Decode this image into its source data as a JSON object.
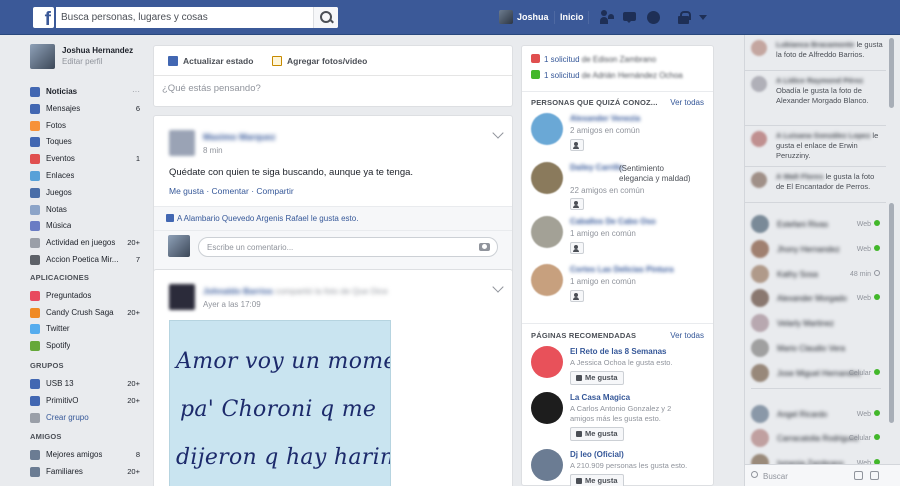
{
  "topbar": {
    "logo": "f",
    "search_placeholder": "Busca personas, lugares y cosas",
    "user_name": "Joshua",
    "home": "Inicio"
  },
  "left": {
    "profile_name": "Joshua Hernandez",
    "edit_profile": "Editar perfil",
    "nav": [
      {
        "label": "Noticias",
        "count": "",
        "color": "#4267b2",
        "active": true,
        "menu": true
      },
      {
        "label": "Mensajes",
        "count": "6",
        "color": "#4267b2"
      },
      {
        "label": "Fotos",
        "count": "",
        "color": "#f7923a"
      },
      {
        "label": "Toques",
        "count": "",
        "color": "#4267b2"
      },
      {
        "label": "Eventos",
        "count": "1",
        "color": "#e04f4f"
      },
      {
        "label": "Enlaces",
        "count": "",
        "color": "#58a1d8"
      },
      {
        "label": "Juegos",
        "count": "",
        "color": "#4a6ea8"
      },
      {
        "label": "Notas",
        "count": "",
        "color": "#8ca4c8"
      },
      {
        "label": "Música",
        "count": "",
        "color": "#6a7cc4"
      },
      {
        "label": "Actividad en juegos",
        "count": "20+",
        "color": "#9a9fa8"
      },
      {
        "label": "Accion Poetica Mir...",
        "count": "7",
        "color": "#5d6168"
      }
    ],
    "apps_title": "APLICACIONES",
    "apps": [
      {
        "label": "Preguntados",
        "count": "",
        "color": "#e84a5f"
      },
      {
        "label": "Candy Crush Saga",
        "count": "20+",
        "color": "#f08a24"
      },
      {
        "label": "Twitter",
        "count": "",
        "color": "#55acee"
      },
      {
        "label": "Spotify",
        "count": "",
        "color": "#65a839"
      }
    ],
    "groups_title": "GRUPOS",
    "groups": [
      {
        "label": "USB 13",
        "count": "20+",
        "color": "#4267b2"
      },
      {
        "label": "PrimitivO",
        "count": "20+",
        "color": "#4267b2"
      },
      {
        "label": "Crear grupo",
        "count": "",
        "color": "#9a9fa8",
        "more": true
      }
    ],
    "friends_title": "AMIGOS",
    "friends": [
      {
        "label": "Mejores amigos",
        "count": "8",
        "color": "#6b7c93"
      },
      {
        "label": "Familiares",
        "count": "20+",
        "color": "#6b7c93"
      }
    ]
  },
  "composer": {
    "tab_status": "Actualizar estado",
    "tab_photo": "Agregar fotos/video",
    "placeholder": "¿Qué estás pensando?"
  },
  "post1": {
    "author": "Maximo Marquez",
    "time": "8 min",
    "text": "Quédate con quien te siga buscando, aunque ya te tenga.",
    "actions": "Me gusta · Comentar · Compartir",
    "likes": "A Alambario Quevedo Argenis Rafael le gusta esto.",
    "comment_placeholder": "Escribe un comentario..."
  },
  "post2": {
    "author": "Johnaldo Barrios",
    "shared": "compartió la foto de Que Dice",
    "time": "Ayer a las 17:09",
    "quote_lines": [
      "Amor voy un momentico",
      "pa' Choroni q me",
      "dijeron q hay harina pan"
    ]
  },
  "right": {
    "requests": [
      {
        "bold": "1 solicitud",
        "rest": " de Edison Zambrano",
        "color": "#e04f4f"
      },
      {
        "bold": "1 solicitud",
        "rest": " de Adrián Hernández Ochoa",
        "color": "#42b72a"
      }
    ],
    "people_title": "PERSONAS QUE QUIZÁ CONOZ...",
    "see_all": "Ver todas",
    "people": [
      {
        "name": "Alexander Venezia",
        "sub1": "2 amigos en común",
        "sub2": "",
        "color": "#6aa8d6"
      },
      {
        "name": "Dailey Carrillo",
        "sub1": "(Sentimiento elegancia y maldad)",
        "sub2": "22 amigos en común",
        "color": "#8a7a5c"
      },
      {
        "name": "Caballos De Cabo Oso",
        "sub1": "1 amigo en común",
        "sub2": "",
        "color": "#a3a196"
      },
      {
        "name": "Cortes Las Delicias Pintura",
        "sub1": "1 amigo en común",
        "sub2": "",
        "color": "#c7a07e"
      }
    ],
    "pages_title": "PÁGINAS RECOMENDADAS",
    "pages_see_all": "Ver todas",
    "pages": [
      {
        "title": "El Reto de las 8 Semanas",
        "sub": "A Jessica Ochoa le gusta esto.",
        "sub2": "",
        "color": "#e8515a"
      },
      {
        "title": "La Casa Magica",
        "sub": "A Carlos Antonio Gonzalez y 2",
        "sub2": "amigos más les gusta esto.",
        "color": "#1d1d1d"
      },
      {
        "title": "Dj leo (Oficial)",
        "sub": "A 210.909 personas les gusta esto.",
        "sub2": "",
        "color": "#6b7c93"
      }
    ],
    "like_label": "Me gusta"
  },
  "chat": {
    "ticker": [
      {
        "name": "Lubianca Bracamonte",
        "text": "le gusta la foto de Alfreddo Barrios.",
        "color": "#c4a6a0"
      },
      {
        "name": "A Lídice Raymond Pérez",
        "text": "Obadía le gusta la foto de Alexander Morgado Blanco.",
        "color": "#b0b0b8"
      },
      {
        "name": "A Luisana González Lopez",
        "text": "le gusta el enlace de Erwin Peruzziny.",
        "color": "#c09090"
      },
      {
        "name": "A Walt Flores",
        "text": "le gusta la foto de El Encantador de Perros.",
        "color": "#a09088"
      }
    ],
    "contacts": [
      {
        "name": "Estefani Rivas",
        "status": "Web",
        "type": "web",
        "color": "#7a8a98"
      },
      {
        "name": "Jhony Hernandez",
        "status": "Web",
        "type": "web",
        "color": "#a08070"
      },
      {
        "name": "Kathy Sosa",
        "status": "48 min",
        "type": "away",
        "color": "#b09a8a"
      },
      {
        "name": "Alexander Morgado",
        "status": "Web",
        "type": "web",
        "color": "#8a7870"
      },
      {
        "name": "Velarly Martinez",
        "status": "",
        "type": "none",
        "color": "#b8a8b0"
      },
      {
        "name": "Mario Claudio Vera",
        "status": "",
        "type": "none",
        "color": "#a0a0a0"
      },
      {
        "name": "Jose Miguel Hernandez",
        "status": "Celular",
        "type": "mobile",
        "color": "#98887a"
      },
      {
        "name": "Angel Ricardo",
        "status": "Web",
        "type": "web",
        "color": "#8a98a8"
      },
      {
        "name": "Carracatolia Rodriguez",
        "status": "Celular",
        "type": "mobile",
        "color": "#c0a0a0"
      },
      {
        "name": "Ismenia Zambrano",
        "status": "Web",
        "type": "web",
        "color": "#9a8a7a"
      }
    ],
    "search_placeholder": "Buscar"
  }
}
